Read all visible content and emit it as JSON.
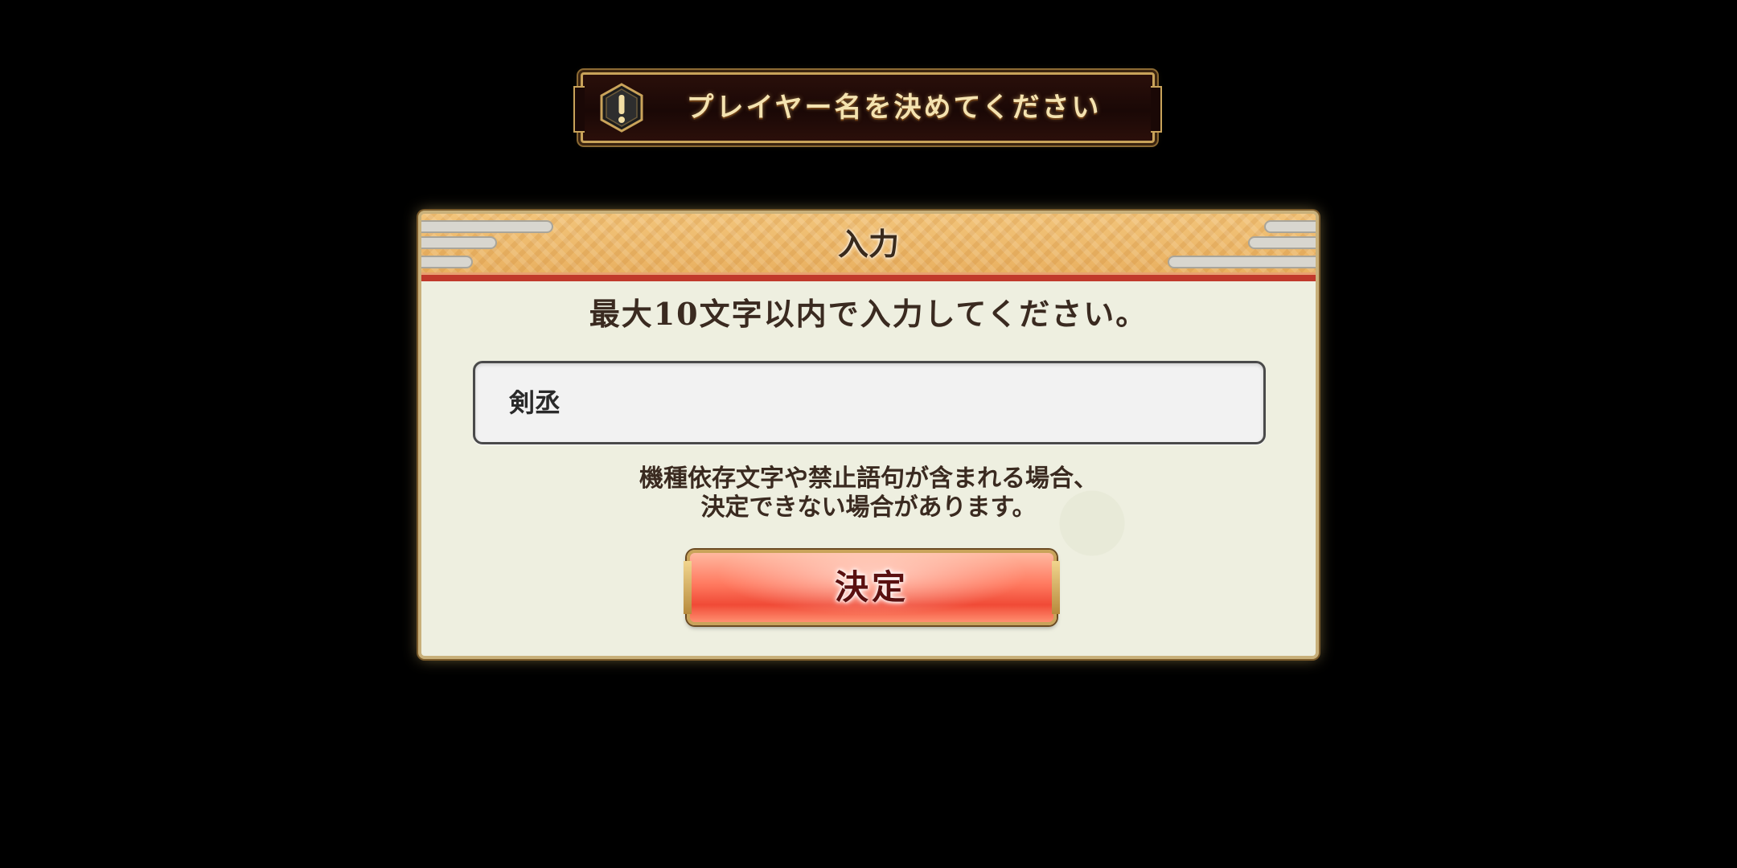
{
  "banner": {
    "icon": "exclamation-hexagon-icon",
    "text": "プレイヤー名を決めてください"
  },
  "dialog": {
    "title": "入力",
    "instruction": "最大10文字以内で入力してください。",
    "input_value": "剣丞",
    "warning_line1": "機種依存文字や禁止語句が含まれる場合、",
    "warning_line2": "決定できない場合があります。",
    "confirm_label": "決定"
  },
  "colors": {
    "background": "#000000",
    "header_gold": "#f2c47a",
    "header_red_stripe": "#c0392b",
    "panel": "#eeefe0",
    "button_red": "#f04a36",
    "gold_trim": "#c9a35a"
  }
}
